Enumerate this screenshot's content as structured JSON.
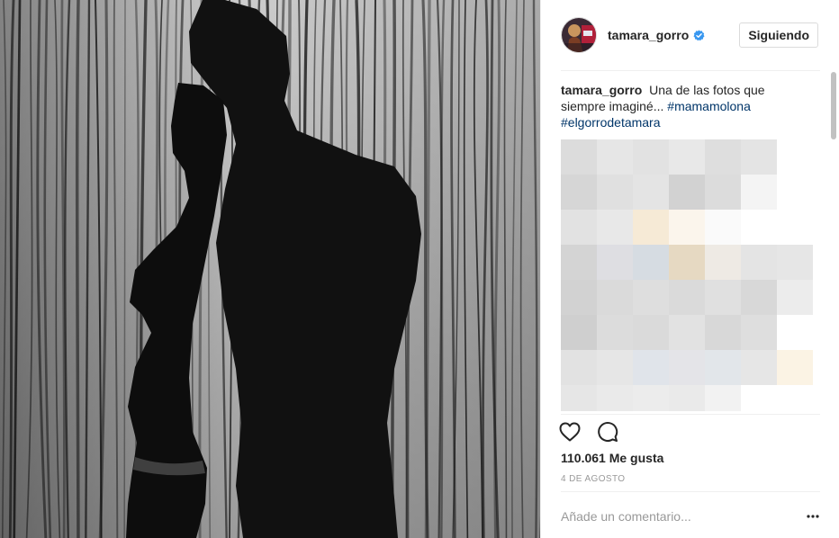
{
  "post": {
    "username": "tamara_gorro",
    "follow_button": "Siguiendo",
    "caption": {
      "username": "tamara_gorro",
      "text": "Una de las fotos que siempre imaginé...",
      "hashtag_1": "#mamamolona",
      "hashtag_2": "#elgorrodetamara"
    },
    "likes": "110.061 Me gusta",
    "date": "4 DE AGOSTO",
    "comment_placeholder": "Añade un comentario..."
  },
  "icons": {
    "verified": "verified-badge-icon",
    "like": "heart-icon",
    "comment": "comment-bubble-icon",
    "more": "more-options-icon"
  },
  "colors": {
    "hashtag": "#003569",
    "verified": "#3897f0"
  }
}
